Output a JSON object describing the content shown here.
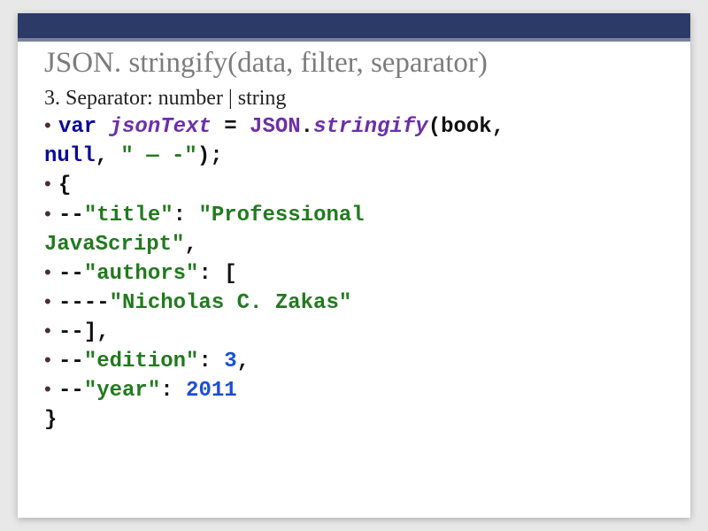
{
  "title": "JSON. stringify(data, filter, separator)",
  "subtitle": "3. Separator: number | string",
  "code": {
    "l1": {
      "var": "var ",
      "ident": "jsonText",
      "eq": " = ",
      "cls": "JSON",
      "dot": ".",
      "method": "stringify",
      "open": "(",
      "arg1": "book",
      "comma": ", "
    },
    "l2": {
      "null": "null",
      "comma": ", ",
      "str": "\" — -\"",
      "close": ");"
    },
    "l3": {
      "text": "{"
    },
    "l4": {
      "dash": "--",
      "key": "\"title\"",
      "colon": ": ",
      "valStart": "\"Professional "
    },
    "l5": {
      "valEnd": "JavaScript\"",
      "comma": ","
    },
    "l6": {
      "dash": "--",
      "key": "\"authors\"",
      "colon": ": ",
      "bracket": "["
    },
    "l7": {
      "dash": "----",
      "val": "\"Nicholas C. Zakas\""
    },
    "l8": {
      "dash": "--",
      "bracket": "],"
    },
    "l9": {
      "dash": "--",
      "key": "\"edition\"",
      "colon": ": ",
      "num": "3",
      "comma": ","
    },
    "l10": {
      "dash": "--",
      "key": "\"year\"",
      "colon": ": ",
      "num": "2011"
    },
    "l11": {
      "text": "}"
    }
  }
}
